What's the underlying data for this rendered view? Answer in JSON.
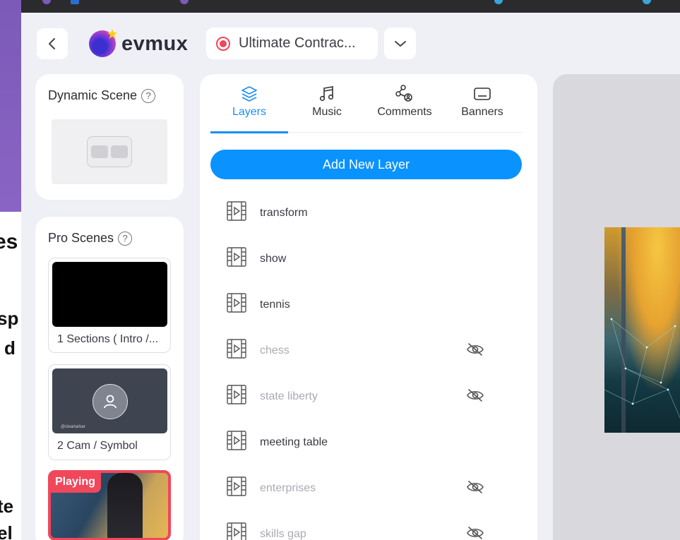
{
  "background_text": [
    "es",
    "sp",
    "d",
    "te",
    "el"
  ],
  "header": {
    "logo_text": "evmux",
    "stream_title": "Ultimate Contrac..."
  },
  "dynamic_scene": {
    "title": "Dynamic Scene",
    "help": "?"
  },
  "pro_scenes": {
    "title": "Pro Scenes",
    "help": "?",
    "items": [
      {
        "label": "1 Sections ( Intro /..."
      },
      {
        "label": "2 Cam / Symbol",
        "cam_text": "@cleartarbar"
      },
      {
        "badge": "Playing"
      }
    ]
  },
  "tabs": [
    {
      "label": "Layers",
      "icon": "layers-icon",
      "active": true
    },
    {
      "label": "Music",
      "icon": "music-icon",
      "active": false
    },
    {
      "label": "Comments",
      "icon": "comments-icon",
      "active": false
    },
    {
      "label": "Banners",
      "icon": "banners-icon",
      "active": false
    }
  ],
  "add_layer_label": "Add New Layer",
  "layers": [
    {
      "name": "transform",
      "hidden": false
    },
    {
      "name": "show",
      "hidden": false
    },
    {
      "name": "tennis",
      "hidden": false
    },
    {
      "name": "chess",
      "hidden": true
    },
    {
      "name": "state liberty",
      "hidden": true
    },
    {
      "name": "meeting table",
      "hidden": false
    },
    {
      "name": "enterprises",
      "hidden": true
    },
    {
      "name": "skills gap",
      "hidden": true
    }
  ],
  "colors": {
    "accent": "#1b8ef5",
    "button": "#0a93ff",
    "live_red": "#f0475b"
  }
}
